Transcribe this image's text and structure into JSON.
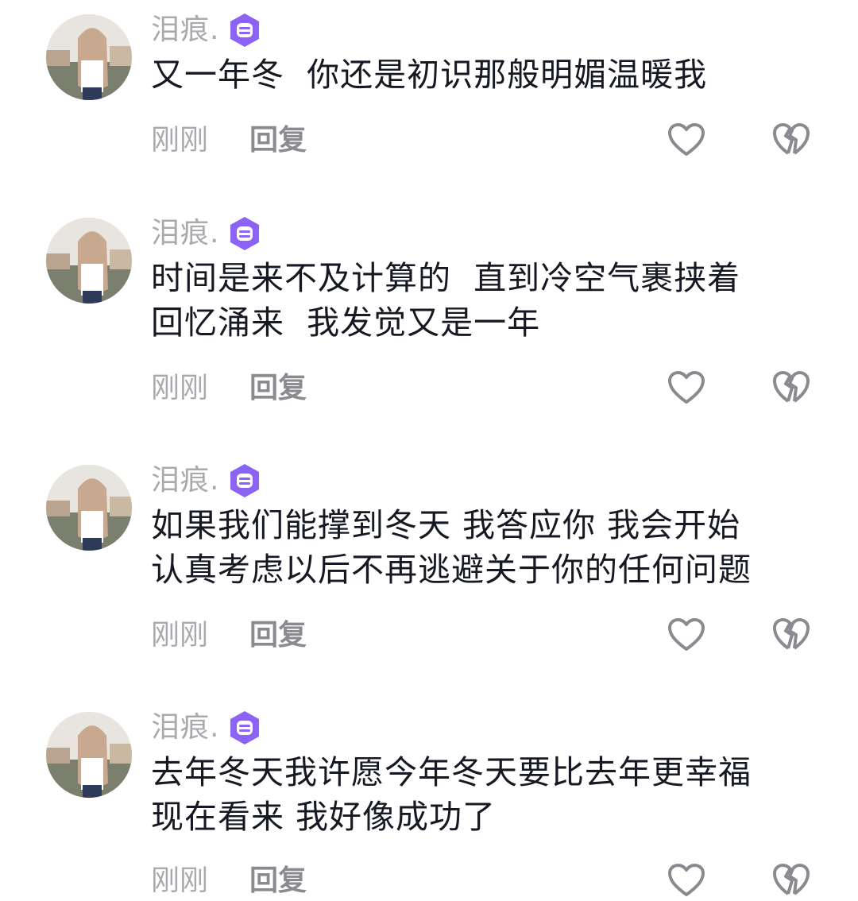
{
  "comments": [
    {
      "username": "泪痕.",
      "text": "又一年冬  你还是初识那般明媚温暖我",
      "time": "刚刚",
      "reply_label": "回复"
    },
    {
      "username": "泪痕.",
      "text": "时间是来不及计算的  直到冷空气裹挟着\n回忆涌来  我发觉又是一年",
      "time": "刚刚",
      "reply_label": "回复"
    },
    {
      "username": "泪痕.",
      "text": "如果我们能撑到冬天 我答应你 我会开始\n认真考虑以后不再逃避关于你的任何问题",
      "time": "刚刚",
      "reply_label": "回复"
    },
    {
      "username": "泪痕.",
      "text": "去年冬天我许愿今年冬天要比去年更幸福\n现在看来 我好像成功了",
      "time": "刚刚",
      "reply_label": "回复"
    }
  ],
  "icons": {
    "badge": "purple-shield-badge-icon",
    "like": "heart-outline-icon",
    "dislike": "broken-heart-outline-icon"
  },
  "colors": {
    "username": "#a9a9ae",
    "text": "#161823",
    "reply": "#8a8b91",
    "badge": "#8b63f5",
    "icon_stroke": "#8a8b91"
  }
}
